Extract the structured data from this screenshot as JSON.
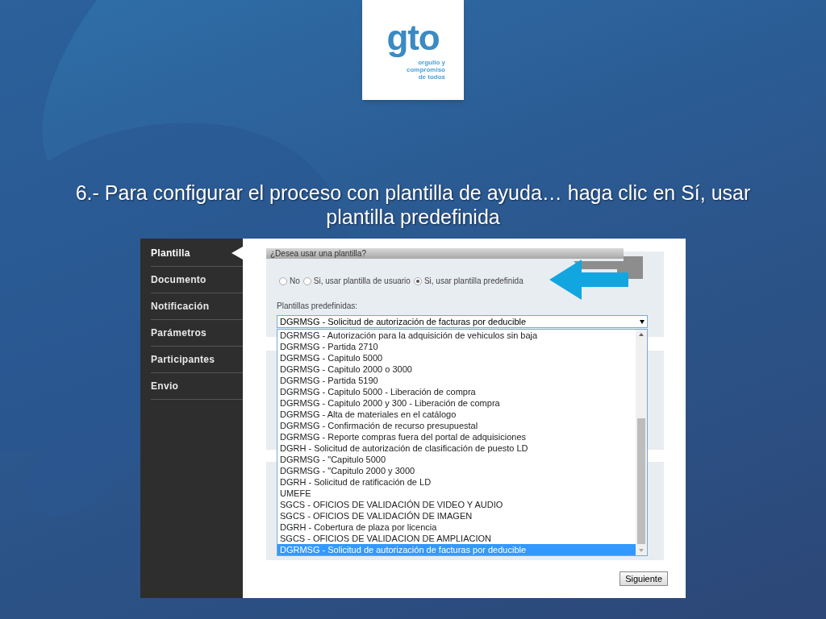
{
  "logo": {
    "mark": "gto",
    "tagline": [
      "orgullo y",
      "compromiso",
      "de todos"
    ]
  },
  "slide_title": "6.- Para configurar el proceso con plantilla de ayuda… haga clic en Sí, usar plantilla predefinida",
  "sidebar": {
    "items": [
      {
        "label": "Plantilla",
        "selected": true
      },
      {
        "label": "Documento",
        "selected": false
      },
      {
        "label": "Notificación",
        "selected": false
      },
      {
        "label": "Parámetros",
        "selected": false
      },
      {
        "label": "Participantes",
        "selected": false
      },
      {
        "label": "Envio",
        "selected": false
      }
    ]
  },
  "question_panel": {
    "title": "¿Desea usar una plantilla?",
    "options": [
      {
        "label": "No",
        "selected": false
      },
      {
        "label": "Si, usar plantilla de usuario",
        "selected": false
      },
      {
        "label": "Si, usar plantilla predefinida",
        "selected": true
      }
    ]
  },
  "template_select": {
    "label": "Plantillas predefinidas:",
    "value": "DGRMSG - Solicitud de autorización de facturas por deducible",
    "options": [
      {
        "label": "DGRMSG - Autorización para la adquisición de vehiculos sin baja",
        "selected": false
      },
      {
        "label": "DGRMSG - Partida 2710",
        "selected": false
      },
      {
        "label": "DGRMSG - Capitulo 5000",
        "selected": false
      },
      {
        "label": "DGRMSG - Capitulo 2000 o 3000",
        "selected": false
      },
      {
        "label": "DGRMSG - Partida 5190",
        "selected": false
      },
      {
        "label": "DGRMSG - Capitulo 5000 - Liberación de compra",
        "selected": false
      },
      {
        "label": "DGRMSG - Capitulo 2000 y 300 - Liberación de compra",
        "selected": false
      },
      {
        "label": "DGRMSG - Alta de materiales en el catálogo",
        "selected": false
      },
      {
        "label": "DGRMSG - Confirmación de recurso presupuestal",
        "selected": false
      },
      {
        "label": "DGRMSG - Reporte compras fuera del portal de adquisiciones",
        "selected": false
      },
      {
        "label": "DGRH - Solicitud de autorización de clasificación de puesto LD",
        "selected": false
      },
      {
        "label": "DGRMSG - \"Capitulo 5000",
        "selected": false
      },
      {
        "label": "DGRMSG - \"Capitulo 2000 y 3000",
        "selected": false
      },
      {
        "label": "DGRH - Solicitud de ratificación de LD",
        "selected": false
      },
      {
        "label": "UMEFE",
        "selected": false
      },
      {
        "label": "SGCS - OFICIOS DE VALIDACIÓN DE VIDEO Y AUDIO",
        "selected": false
      },
      {
        "label": "SGCS - OFICIOS DE VALIDACIÓN DE IMAGEN",
        "selected": false
      },
      {
        "label": "DGRH - Cobertura de plaza por licencia",
        "selected": false
      },
      {
        "label": "SGCS - OFICIOS DE VALIDACION DE AMPLIACION",
        "selected": false
      },
      {
        "label": "DGRMSG - Solicitud de autorización de facturas por deducible",
        "selected": true
      }
    ]
  },
  "next_button": "Siguiente"
}
